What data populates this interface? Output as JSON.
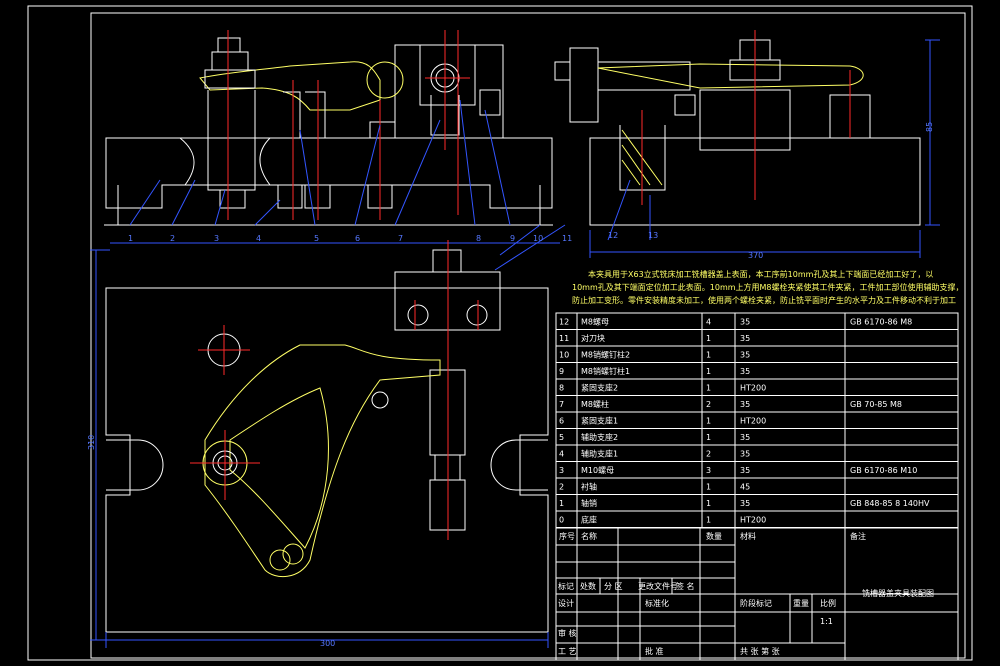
{
  "colors": {
    "background": "#000000",
    "outline": "#ffffff",
    "part": "#ffff66",
    "centerline": "#ff2a2a",
    "dimension": "#3355ff"
  },
  "title_block": {
    "drawing_title": "铣槽器盖夹具装配图",
    "scale": "1:1",
    "row_mark": "标记",
    "row_count": "处数",
    "row_zone": "分 区",
    "row_change": "更改文件号",
    "row_sign": "签 名",
    "design": "设计",
    "standard": "标准化",
    "stage": "阶段标记",
    "weight": "重量",
    "ratio": "比例",
    "review": "审 核",
    "process": "工 艺",
    "approve": "批 准",
    "sheet_total": "共 张 第 张"
  },
  "note": [
    "本夹具用于X63立式铣床加工铣槽器盖上表面，本工序前10mm孔及其上下端面已经加工好了，以",
    "10mm孔及其下端面定位加工此表面。10mm上方用M8螺栓夹紧使其工件夹紧，工件加工部位使用辅助支撑，",
    "防止加工变形。零件安装精度未加工，使用两个螺栓夹紧，防止铣平面时产生的水平力及工件移动不利于加工"
  ],
  "bom_header": {
    "no": "序号",
    "name": "名称",
    "qty": "数量",
    "material": "材料",
    "remark": "备注"
  },
  "bom": [
    {
      "no": "12",
      "name": "M8螺母",
      "qty": "4",
      "material": "35",
      "remark": "GB 6170-86 M8"
    },
    {
      "no": "11",
      "name": "对刀块",
      "qty": "1",
      "material": "35",
      "remark": ""
    },
    {
      "no": "10",
      "name": "M8销螺钉柱2",
      "qty": "1",
      "material": "35",
      "remark": ""
    },
    {
      "no": "9",
      "name": "M8销螺钉柱1",
      "qty": "1",
      "material": "35",
      "remark": ""
    },
    {
      "no": "8",
      "name": "紧固支座2",
      "qty": "1",
      "material": "HT200",
      "remark": ""
    },
    {
      "no": "7",
      "name": "M8螺柱",
      "qty": "2",
      "material": "35",
      "remark": "GB 70-85 M8"
    },
    {
      "no": "6",
      "name": "紧固支座1",
      "qty": "1",
      "material": "HT200",
      "remark": ""
    },
    {
      "no": "5",
      "name": "辅助支座2",
      "qty": "1",
      "material": "35",
      "remark": ""
    },
    {
      "no": "4",
      "name": "辅助支座1",
      "qty": "2",
      "material": "35",
      "remark": ""
    },
    {
      "no": "3",
      "name": "M10螺母",
      "qty": "3",
      "material": "35",
      "remark": "GB 6170-86 M10"
    },
    {
      "no": "2",
      "name": "衬轴",
      "qty": "1",
      "material": "45",
      "remark": ""
    },
    {
      "no": "1",
      "name": "轴销",
      "qty": "1",
      "material": "35",
      "remark": "GB 848-85 8 140HV"
    },
    {
      "no": "0",
      "name": "底座",
      "qty": "1",
      "material": "HT200",
      "remark": ""
    }
  ],
  "balloons": [
    "1",
    "2",
    "3",
    "4",
    "5",
    "6",
    "7",
    "8",
    "9",
    "10",
    "11"
  ],
  "side_balloons": [
    "12",
    "13"
  ],
  "dims": {
    "front_width": "370",
    "plan_width": "300",
    "plan_height": "310",
    "side_height": "85"
  }
}
